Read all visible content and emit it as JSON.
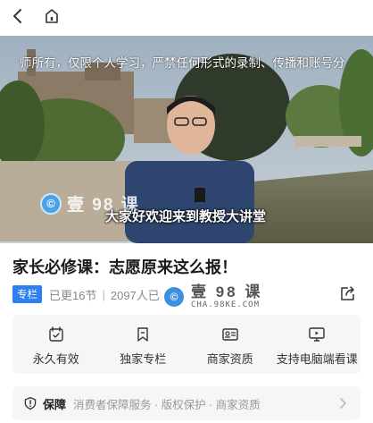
{
  "topbar": {
    "back_icon": "chevron-left-icon",
    "home_icon": "home-icon"
  },
  "video": {
    "marquee": "师所有，仅限个人学习，严禁任何形式的录制、传播和账号分",
    "subtitle": "大家好欢迎来到教授大讲堂",
    "watermark_text": "壹 98 课",
    "watermark_logo": "©"
  },
  "course": {
    "title": "家长必修课：志愿原来这么报！"
  },
  "meta": {
    "badge": "专栏",
    "updated": "已更16节",
    "learners": "2097人已学",
    "watermark_text": "壹 98 课",
    "watermark_url": "CHA.98KE.COM",
    "watermark_logo": "©"
  },
  "features": [
    {
      "label": "永久有效",
      "icon": "calendar-icon"
    },
    {
      "label": "独家专栏",
      "icon": "bookmark-icon"
    },
    {
      "label": "商家资质",
      "icon": "id-card-icon"
    },
    {
      "label": "支持电脑端看课",
      "icon": "monitor-icon"
    }
  ],
  "guarantee": {
    "label": "保障",
    "text": "消费者保障服务 · 版权保护 · 商家资质"
  },
  "colors": {
    "badge": "#2f7ff0",
    "panel": "#f5f6f8",
    "text_muted": "#8a8a8a"
  }
}
